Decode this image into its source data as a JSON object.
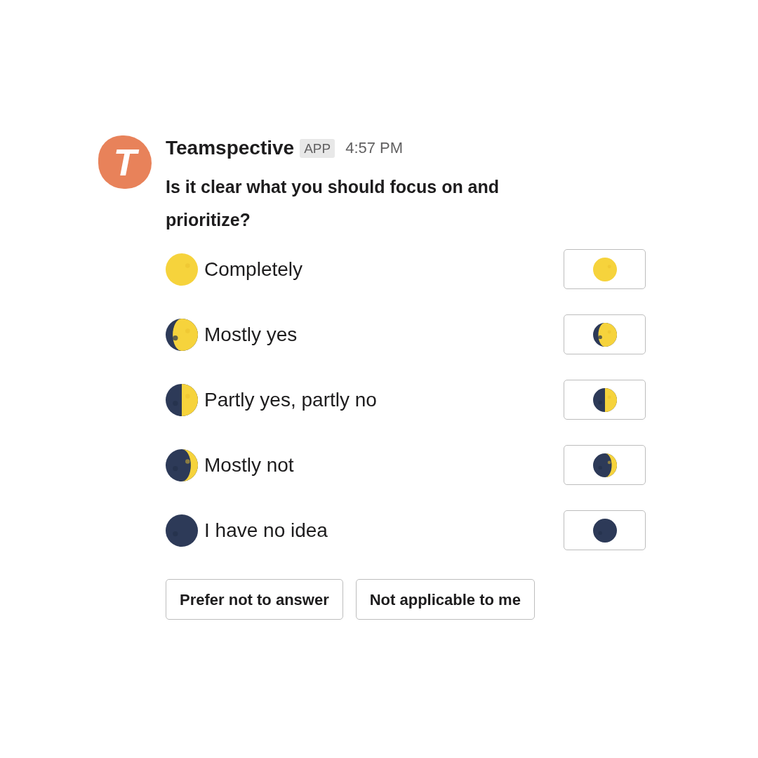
{
  "message": {
    "avatar_letter": "T",
    "sender": "Teamspective",
    "badge": "APP",
    "time": "4:57 PM",
    "question": "Is it clear what you should focus on and prioritize?"
  },
  "options": [
    {
      "kind": "full",
      "label": "Completely"
    },
    {
      "kind": "gibbous",
      "label": "Mostly yes"
    },
    {
      "kind": "quarter",
      "label": "Partly yes, partly no"
    },
    {
      "kind": "crescent",
      "label": "Mostly not"
    },
    {
      "kind": "new",
      "label": "I have no idea"
    }
  ],
  "extra_buttons": [
    "Prefer not to answer",
    "Not applicable to me"
  ]
}
